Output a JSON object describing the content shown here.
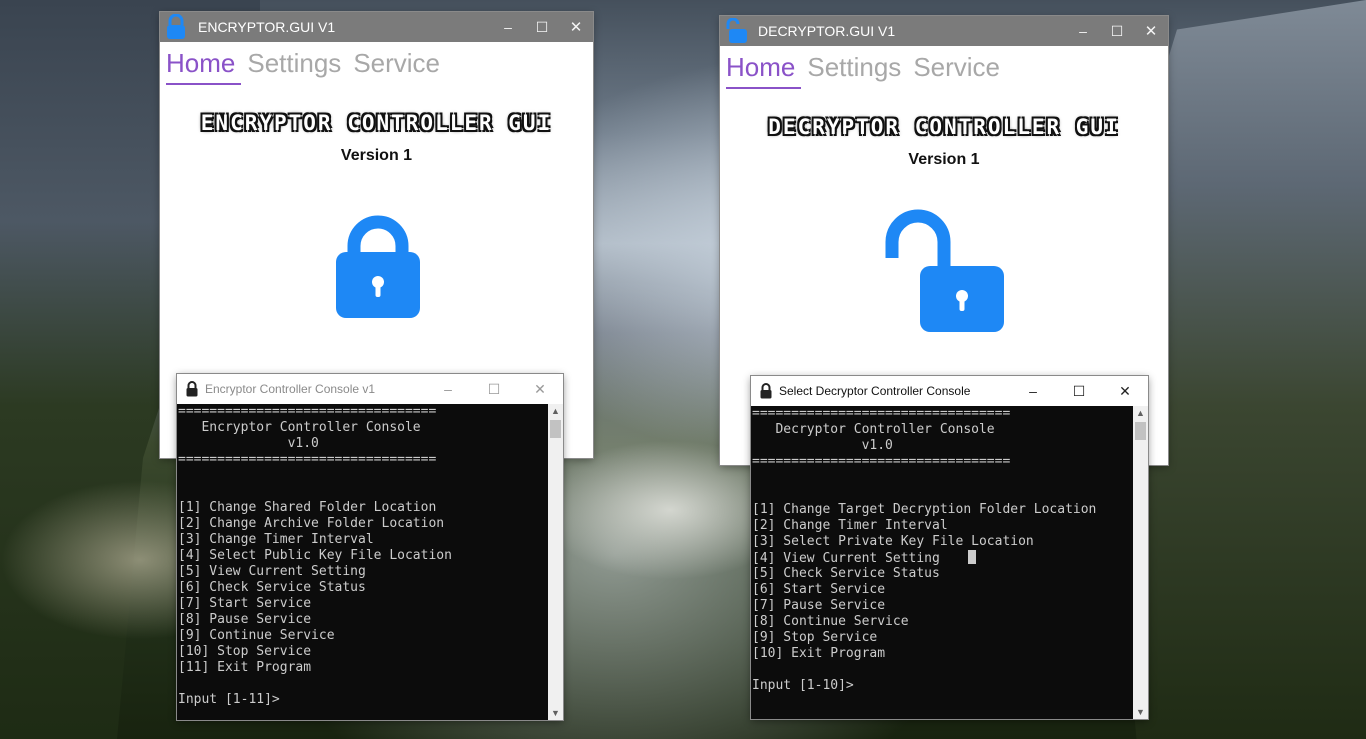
{
  "encryptor_gui": {
    "title": "ENCRYPTOR.GUI V1",
    "tabs": [
      "Home",
      "Settings",
      "Service"
    ],
    "heading": "ENCRYPTOR CONTROLLER GUI",
    "version": "Version 1"
  },
  "decryptor_gui": {
    "title": "DECRYPTOR.GUI V1",
    "tabs": [
      "Home",
      "Settings",
      "Service"
    ],
    "heading": "DECRYPTOR CONTROLLER GUI",
    "version": "Version 1"
  },
  "window_controls": {
    "minimize": "‒",
    "maximize": "☐",
    "close": "✕"
  },
  "encryptor_console": {
    "title": "Encryptor Controller Console v1",
    "lines": [
      "=================================",
      "   Encryptor Controller Console",
      "              v1.0",
      "=================================",
      "",
      "",
      "[1] Change Shared Folder Location",
      "[2] Change Archive Folder Location",
      "[3] Change Timer Interval",
      "[4] Select Public Key File Location",
      "[5] View Current Setting",
      "[6] Check Service Status",
      "[7] Start Service",
      "[8] Pause Service",
      "[9] Continue Service",
      "[10] Stop Service",
      "[11] Exit Program",
      "",
      "Input [1-11]>"
    ]
  },
  "decryptor_console": {
    "title": "Select Decryptor Controller Console",
    "lines": [
      "=================================",
      "   Decryptor Controller Console",
      "              v1.0",
      "=================================",
      "",
      "",
      "[1] Change Target Decryption Folder Location",
      "[2] Change Timer Interval",
      "[3] Select Private Key File Location",
      "[4] View Current Setting",
      "[5] Check Service Status",
      "[6] Start Service",
      "[7] Pause Service",
      "[8] Continue Service",
      "[9] Stop Service",
      "[10] Exit Program",
      "",
      "Input [1-10]>"
    ]
  },
  "colors": {
    "accent_tab": "#8a52c8",
    "lock_blue": "#1e88f5",
    "titlebar_gray": "#7b7b7b",
    "console_bg": "#0c0c0c",
    "console_text": "#cccccc"
  },
  "icons": {
    "closed_lock": "lock-closed-icon",
    "open_lock": "lock-open-icon"
  }
}
